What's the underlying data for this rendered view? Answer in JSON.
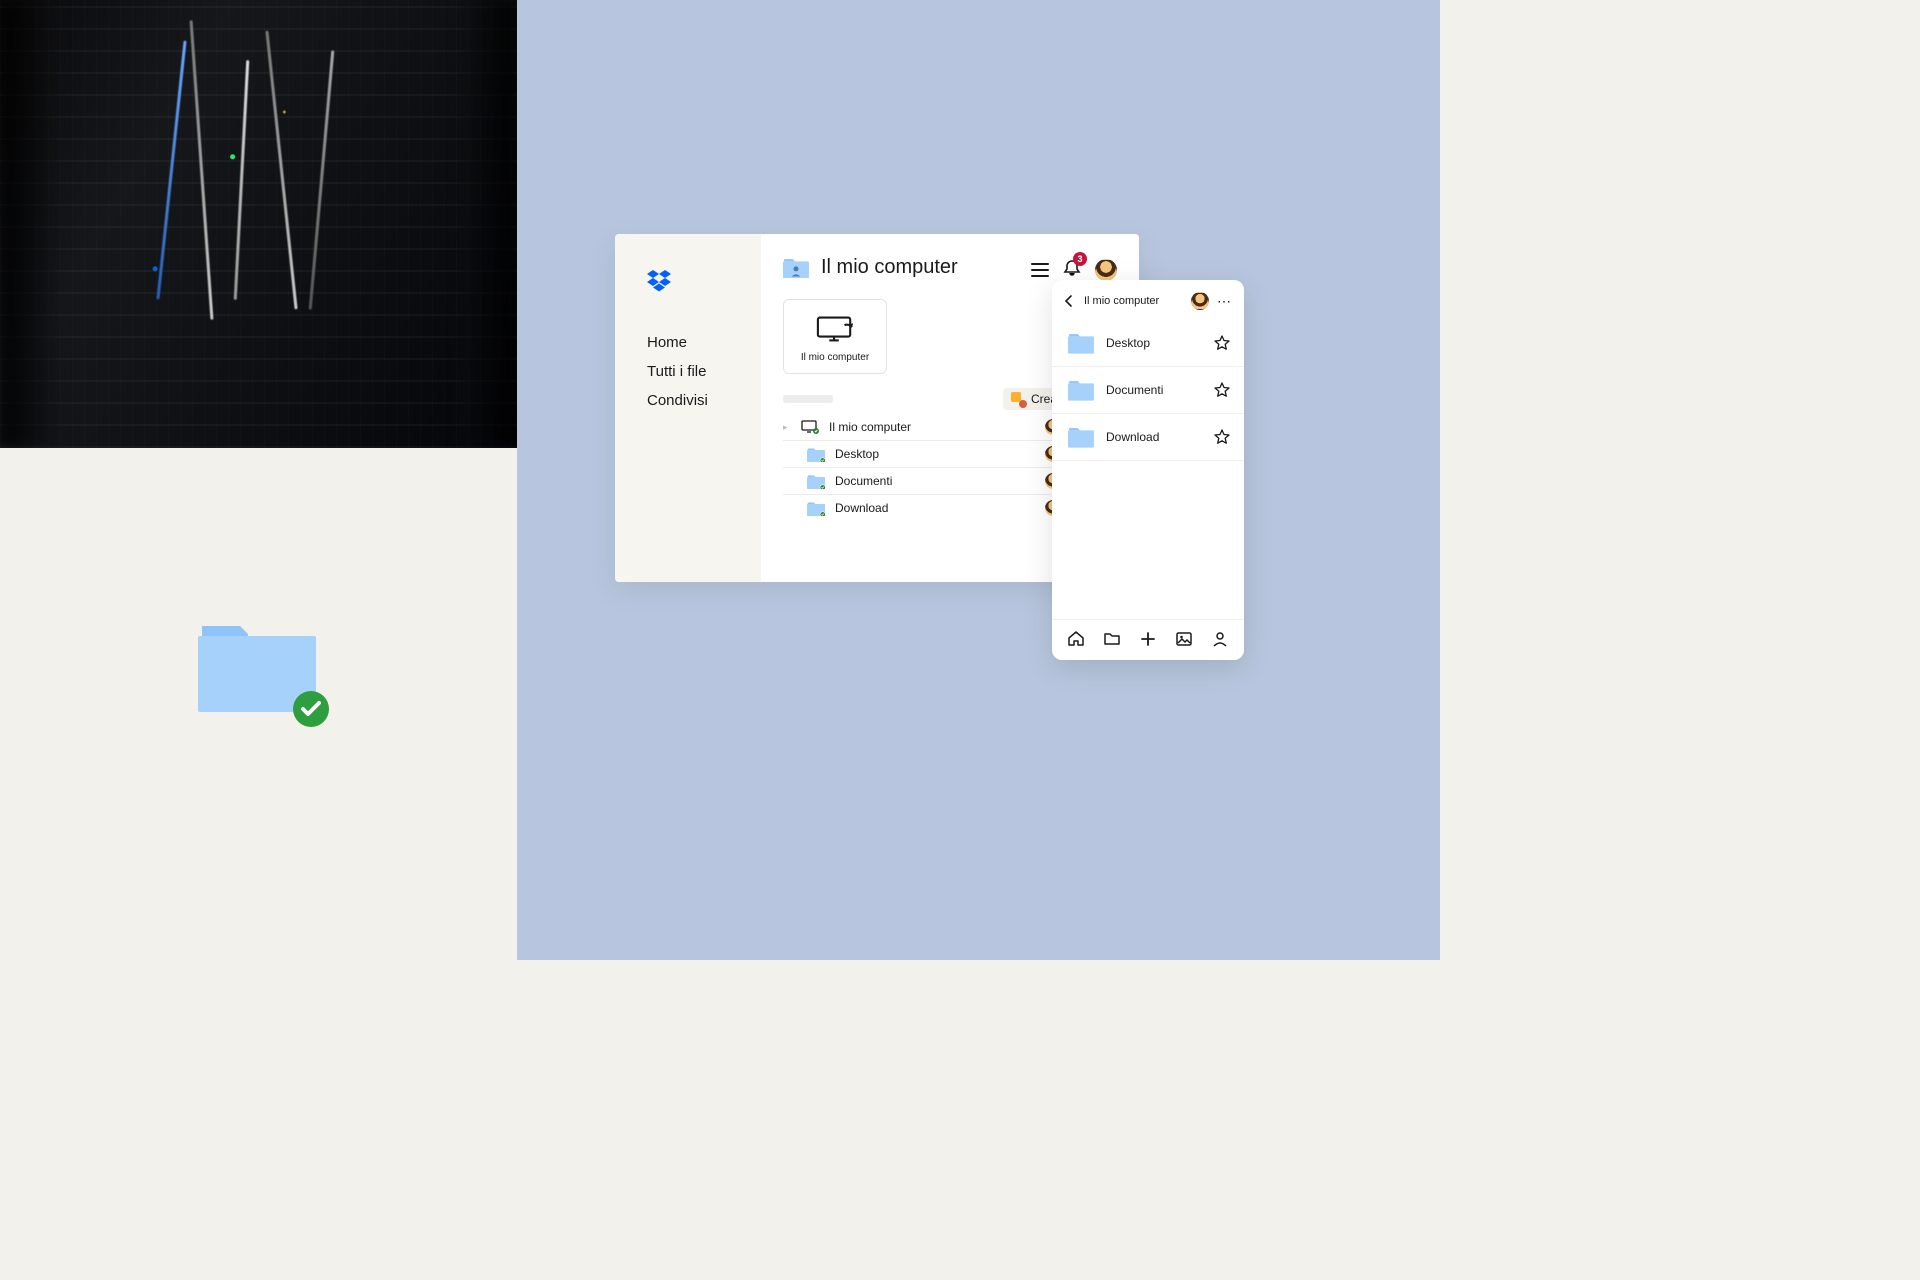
{
  "colors": {
    "accent_blue": "#0061fe",
    "folder_blue": "#a6d1fb",
    "bg_blue": "#b7c6de",
    "badge_red": "#c8133b",
    "check_green": "#2e7d32"
  },
  "desktop": {
    "title": "Il mio computer",
    "sidebar": {
      "items": [
        "Home",
        "Tutti i file",
        "Condivisi"
      ]
    },
    "card": {
      "label": "Il mio computer"
    },
    "create_button": "Crea",
    "notification_count": "3",
    "rows": [
      {
        "label": "Il mio computer",
        "indent": 0,
        "type": "computer"
      },
      {
        "label": "Desktop",
        "indent": 1,
        "type": "folder"
      },
      {
        "label": "Documenti",
        "indent": 1,
        "type": "folder"
      },
      {
        "label": "Download",
        "indent": 1,
        "type": "folder"
      }
    ]
  },
  "mobile": {
    "title": "Il mio computer",
    "items": [
      "Desktop",
      "Documenti",
      "Download"
    ]
  }
}
